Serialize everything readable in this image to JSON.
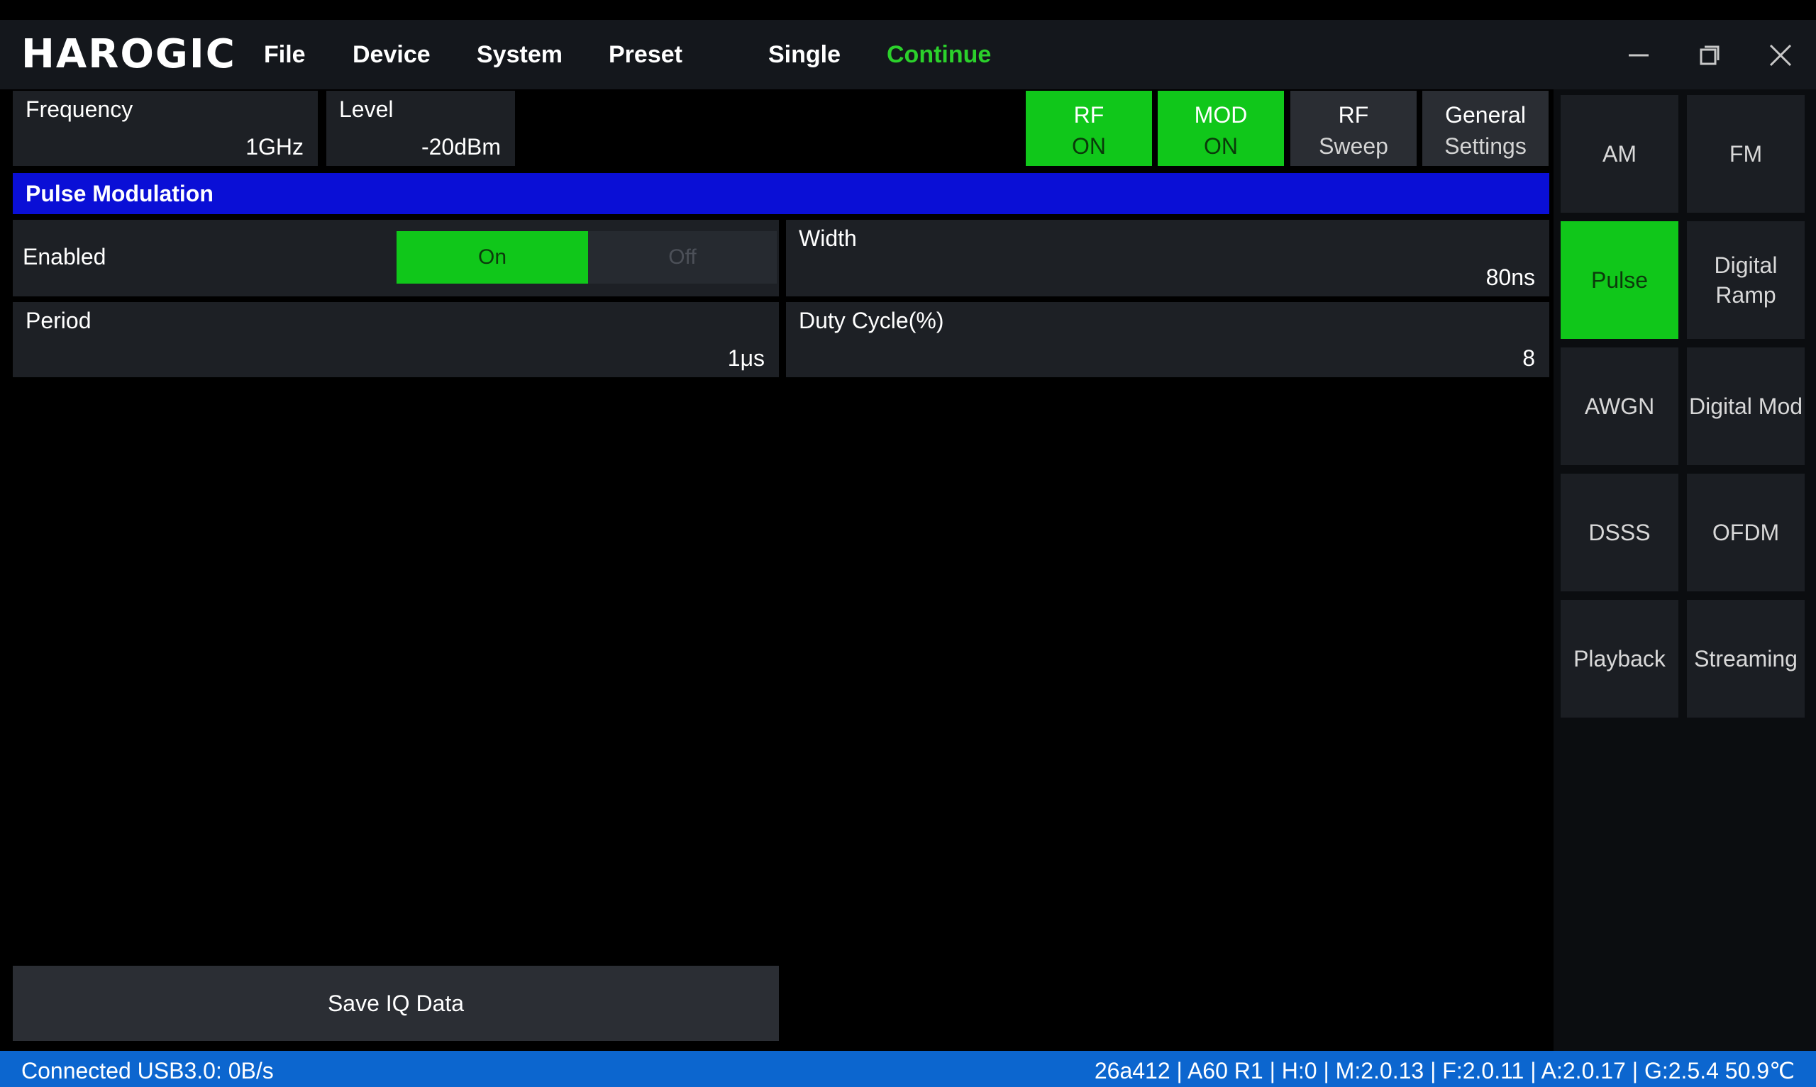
{
  "app": {
    "logo_text": "HAROGIC"
  },
  "menu": {
    "items": [
      "File",
      "Device",
      "System",
      "Preset"
    ],
    "single_label": "Single",
    "continue_label": "Continue",
    "active_color": "#2bd12b"
  },
  "params": {
    "frequency": {
      "label": "Frequency",
      "value": "1GHz"
    },
    "level": {
      "label": "Level",
      "value": "-20dBm"
    }
  },
  "toolbar": {
    "rf_on": {
      "line1": "RF",
      "line2": "ON",
      "active": true
    },
    "mod_on": {
      "line1": "MOD",
      "line2": "ON",
      "active": true
    },
    "rf_sweep": {
      "line1": "RF",
      "line2": "Sweep",
      "active": false
    },
    "general_settings": {
      "line1": "General",
      "line2": "Settings",
      "active": false
    }
  },
  "section": {
    "title": "Pulse Modulation"
  },
  "pulse": {
    "enabled": {
      "label": "Enabled",
      "on_label": "On",
      "off_label": "Off",
      "selected": "On"
    },
    "width": {
      "label": "Width",
      "value": "80ns"
    },
    "period": {
      "label": "Period",
      "value": "1μs"
    },
    "duty_cycle": {
      "label": "Duty Cycle(%)",
      "value": "8"
    }
  },
  "side_menu": {
    "items": [
      {
        "label": "AM",
        "active": false
      },
      {
        "label": "FM",
        "active": false
      },
      {
        "label": "Pulse",
        "active": true
      },
      {
        "label": "Digital Ramp",
        "active": false
      },
      {
        "label": "AWGN",
        "active": false
      },
      {
        "label": "Digital Mod",
        "active": false
      },
      {
        "label": "DSSS",
        "active": false
      },
      {
        "label": "OFDM",
        "active": false
      },
      {
        "label": "Playback",
        "active": false
      },
      {
        "label": "Streaming",
        "active": false
      }
    ]
  },
  "actions": {
    "save_iq_label": "Save IQ Data"
  },
  "status": {
    "connection": "Connected USB3.0: 0B/s",
    "device_info": "26a412 | A60 R1 | H:0 | M:2.0.13 | F:2.0.11 | A:2.0.17 | G:2.5.4  50.9℃"
  },
  "colors": {
    "accent_green": "#10c71a",
    "section_blue": "#0a0fd6",
    "status_blue": "#0c66cf"
  }
}
